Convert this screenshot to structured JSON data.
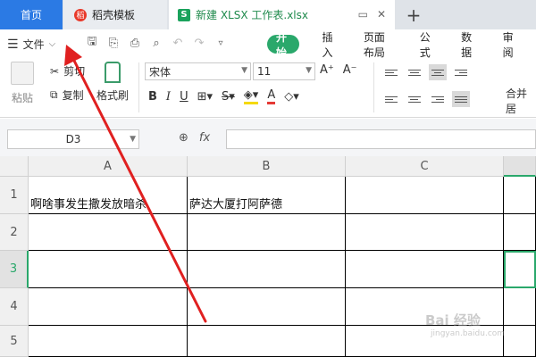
{
  "tabs": {
    "home": "首页",
    "templates": "稻壳模板",
    "file": "新建 XLSX 工作表.xlsx",
    "plus": "+"
  },
  "menu": {
    "file_label": "文件",
    "tabs": [
      "开始",
      "插入",
      "页面布局",
      "公式",
      "数据",
      "审阅"
    ]
  },
  "ribbon": {
    "paste": "粘贴",
    "cut": "剪切",
    "copy": "复制",
    "format_painter": "格式刷",
    "font_name": "宋体",
    "font_size": "11",
    "bold": "B",
    "italic": "I",
    "underline": "U",
    "grow_font": "A⁺",
    "shrink_font": "A⁻",
    "font_color": "A",
    "wrap_label": "合并居",
    "font_color_accent": "#e53935",
    "fill_color_accent": "#f5d90a"
  },
  "formula_bar": {
    "cell_ref": "D3",
    "fx": "fx",
    "formula": ""
  },
  "sheet": {
    "columns": [
      "A",
      "B",
      "C"
    ],
    "rows": [
      "1",
      "2",
      "3",
      "4",
      "5"
    ],
    "cells": {
      "A1": "啊啥事发生撒发放暗杀",
      "B1": "萨达大厦打阿萨德"
    }
  },
  "watermark": {
    "text": "Bai 经验",
    "sub": "jingyan.baidu.com"
  },
  "colors": {
    "accent_green": "#2aa86b",
    "home_tab_blue": "#2b7ae4",
    "annotation_red": "#e02020"
  }
}
